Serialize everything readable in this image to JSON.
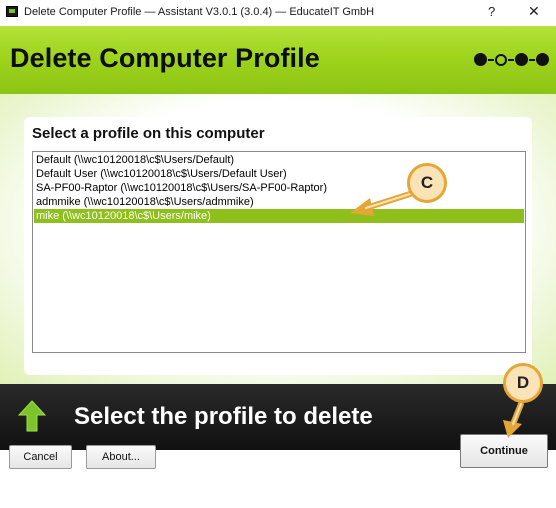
{
  "window": {
    "title": "Delete Computer Profile — Assistant V3.0.1 (3.0.4) — EducateIT GmbH",
    "help_glyph": "?",
    "close_glyph": "✕"
  },
  "header": {
    "title": "Delete Computer Profile",
    "step_indicator": {
      "total": 4,
      "current": 2
    }
  },
  "main": {
    "list_heading": "Select a profile on this computer",
    "profiles": [
      {
        "label": "Default (\\\\wc10120018\\c$\\Users/Default)",
        "selected": false
      },
      {
        "label": "Default User (\\\\wc10120018\\c$\\Users/Default User)",
        "selected": false
      },
      {
        "label": "SA-PF00-Raptor (\\\\wc10120018\\c$\\Users/SA-PF00-Raptor)",
        "selected": false
      },
      {
        "label": "admmike (\\\\wc10120018\\c$\\Users/admmike)",
        "selected": false
      },
      {
        "label": "mike (\\\\wc10120018\\c$\\Users/mike)",
        "selected": true
      }
    ]
  },
  "callouts": {
    "c": "C",
    "d": "D"
  },
  "instruction": {
    "text": "Select the profile to delete",
    "icon": "up-arrow-icon"
  },
  "footer": {
    "cancel_label": "Cancel",
    "about_label": "About...",
    "continue_label": "Continue"
  },
  "colors": {
    "header_green": "#9fd41c",
    "selection_green": "#8fbf1a",
    "callout_fill": "#fbe3b8",
    "callout_border": "#e5a638",
    "band_dark": "#161616"
  }
}
